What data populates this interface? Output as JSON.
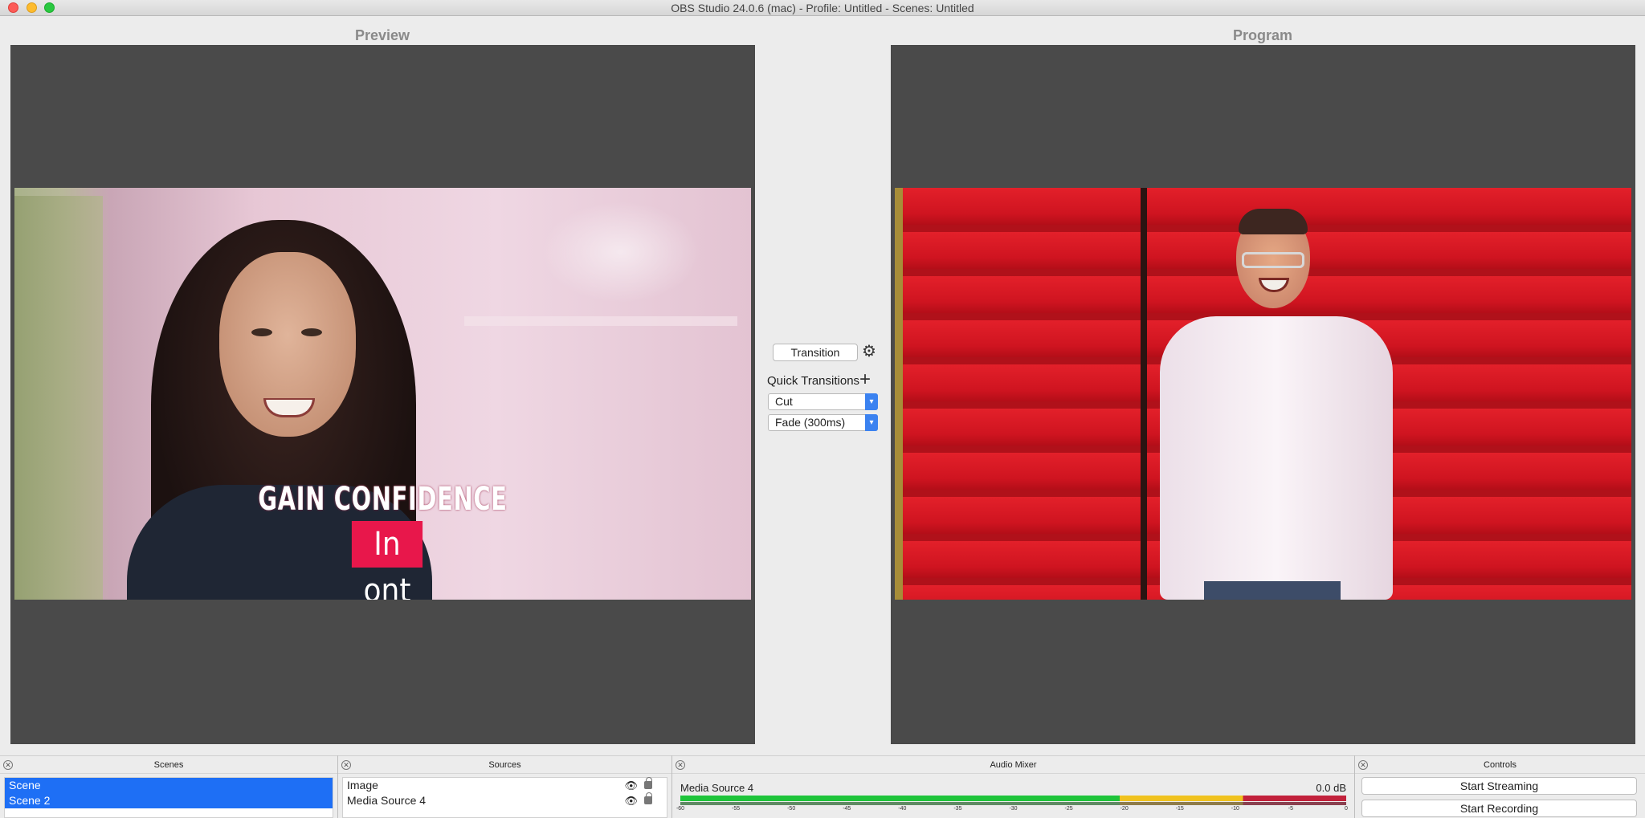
{
  "window": {
    "title": "OBS Studio 24.0.6 (mac) - Profile: Untitled - Scenes: Untitled"
  },
  "preview": {
    "heading": "Preview",
    "caption_line1": "GAIN CONFIDENCE",
    "caption_line2": "In ont"
  },
  "program": {
    "heading": "Program"
  },
  "transition_panel": {
    "transition_label": "Transition",
    "quick_transitions_label": "Quick Transitions",
    "items": [
      "Cut",
      "Fade (300ms)"
    ],
    "gear_icon": "gear-icon",
    "add_icon": "plus-icon"
  },
  "docks": {
    "scenes": {
      "title": "Scenes",
      "items": [
        "Scene",
        "Scene 2"
      ]
    },
    "sources": {
      "title": "Sources",
      "items": [
        "Image",
        "Media Source 4"
      ]
    },
    "audio_mixer": {
      "title": "Audio Mixer",
      "source_name": "Media Source 4",
      "level": "0.0 dB",
      "scale": [
        "-60",
        "-55",
        "-50",
        "-45",
        "-40",
        "-35",
        "-30",
        "-25",
        "-20",
        "-15",
        "-10",
        "-5",
        "0"
      ]
    },
    "controls": {
      "title": "Controls",
      "start_streaming": "Start Streaming",
      "start_recording": "Start Recording"
    }
  },
  "colors": {
    "selection": "#1e6ff5",
    "canvas_bg": "#4a4a4a",
    "meter_green": "#1ec43a",
    "meter_yellow": "#f0c21e",
    "meter_red": "#c2213b"
  }
}
